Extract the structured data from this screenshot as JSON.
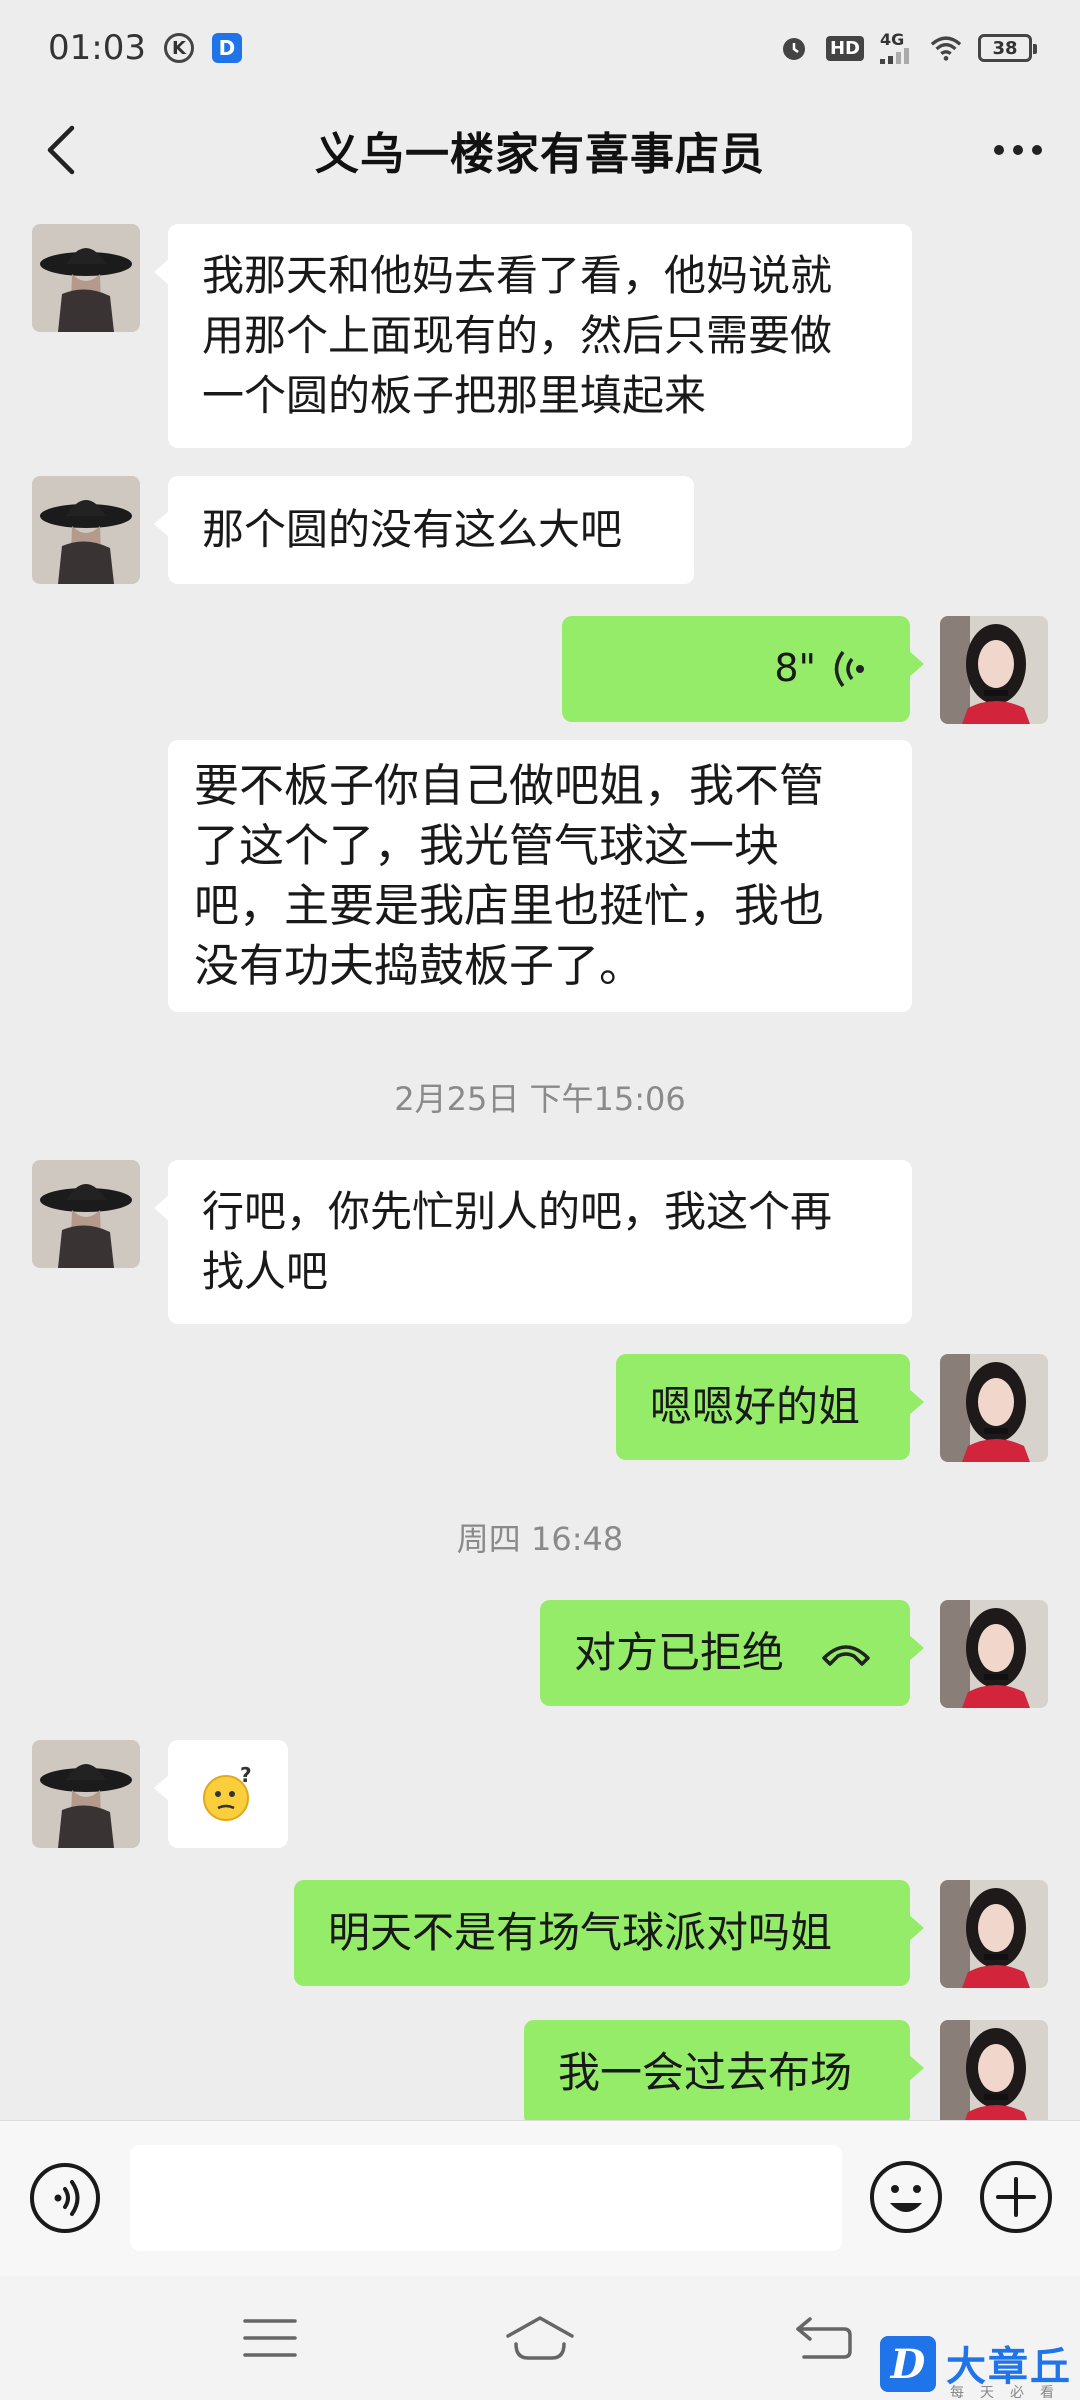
{
  "status_bar": {
    "time": "01:03",
    "k_badge": "K",
    "d_badge": "D",
    "hd": "HD",
    "network": "4G",
    "battery": "38"
  },
  "header": {
    "title": "义乌一楼家有喜事店员"
  },
  "messages": [
    {
      "side": "in",
      "text": "我那天和他妈去看了看，他妈说就\n用那个上面现有的，然后只需要做\n一个圆的板子把那里填起来"
    },
    {
      "side": "in",
      "text": "那个圆的没有这么大吧"
    },
    {
      "side": "out",
      "type": "voice",
      "text": "8\""
    },
    {
      "side": "in",
      "text": "要不板子你自己做吧姐，我不管\n了这个了，我光管气球这一块\n吧，主要是我店里也挺忙，我也\n没有功夫捣鼓板子了。"
    },
    {
      "type": "time",
      "text": "2月25日 下午15:06"
    },
    {
      "side": "in",
      "text": "行吧，你先忙别人的吧，我这个再\n找人吧"
    },
    {
      "side": "out",
      "text": "嗯嗯好的姐"
    },
    {
      "type": "time",
      "text": "周四 16:48"
    },
    {
      "side": "out",
      "type": "call",
      "text": "对方已拒绝"
    },
    {
      "side": "in",
      "type": "emoji",
      "text": "🤔"
    },
    {
      "side": "out",
      "text": "明天不是有场气球派对吗姐"
    },
    {
      "side": "out",
      "text": "我一会过去布场"
    }
  ],
  "watermark": {
    "logo": "D",
    "brand": "大章丘",
    "tagline": "每天必看"
  },
  "colors": {
    "outgoing_bubble": "#95ec69",
    "incoming_bubble": "#ffffff",
    "background": "#ededed"
  }
}
